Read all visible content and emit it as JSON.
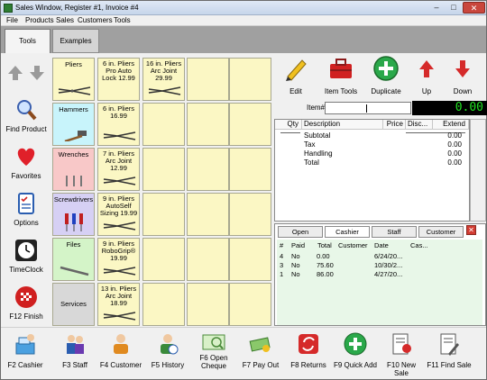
{
  "window": {
    "title": "Sales Window,  Register #1,  Invoice #4",
    "min": "–",
    "max": "□",
    "close": "✕"
  },
  "menu": [
    "File",
    "Products",
    "Sales",
    "Customers",
    "Tools"
  ],
  "tabs": {
    "tools": "Tools",
    "examples": "Examples"
  },
  "leftnav": {
    "find_product": "Find Product",
    "favorites": "Favorites",
    "options": "Options",
    "timeclock": "TimeClock",
    "f12_finish": "F12 Finish"
  },
  "categories": [
    "Pliers",
    "Hammers",
    "Wrenches",
    "Screwdrivers",
    "Files",
    "Services"
  ],
  "products_col1": [
    "6 in. Pliers Pro Auto Lock 12.99",
    "6 in. Pliers 16.99",
    "7 in. Pliers Arc Joint 12.99",
    "9 in. Pliers AutoSelf Sizing 19.99",
    "9 in. Pliers RoboGrip® 19.99",
    "13 in. Pliers Arc Joint 18.99"
  ],
  "products_col2": [
    "16 in. Pliers Arc Joint 29.99"
  ],
  "toolbar": {
    "edit": "Edit",
    "item_tools": "Item Tools",
    "duplicate": "Duplicate",
    "up": "Up",
    "down": "Down"
  },
  "item": {
    "label": "Item#",
    "value": "",
    "placeholder": ""
  },
  "total_display": "0.00",
  "lines": {
    "headers": [
      "Qty",
      "Description",
      "Price",
      "Disc...",
      "Extend"
    ],
    "rows": [
      {
        "label": "Subtotal",
        "value": "0.00"
      },
      {
        "label": "Tax",
        "value": "0.00"
      },
      {
        "label": "Handling",
        "value": "0.00"
      },
      {
        "label": "Total",
        "value": "0.00"
      }
    ]
  },
  "lower_tabs": [
    "Open",
    "Cashier",
    "Staff",
    "Customer"
  ],
  "invoices": {
    "headers": [
      "#",
      "Paid",
      "Total",
      "Customer",
      "Date",
      "Cas..."
    ],
    "rows": [
      {
        "num": "4",
        "paid": "No",
        "total": "0.00",
        "customer": "",
        "date": "6/24/20...",
        "cashier": ""
      },
      {
        "num": "3",
        "paid": "No",
        "total": "75.60",
        "customer": "",
        "date": "10/30/2...",
        "cashier": ""
      },
      {
        "num": "1",
        "paid": "No",
        "total": "86.00",
        "customer": "",
        "date": "4/27/20...",
        "cashier": ""
      }
    ]
  },
  "bottom": {
    "f2": "F2 Cashier",
    "f3": "F3 Staff",
    "f4": "F4 Customer",
    "f5": "F5 History",
    "f6a": "F6 Open",
    "f6b": "Cheque",
    "f7": "F7 Pay Out",
    "f8": "F8 Returns",
    "f9": "F9 Quick Add",
    "f10": "F10 New Sale",
    "f11": "F11 Find Sale"
  },
  "colors": {
    "pliers": "#fbf7c4",
    "hammers": "#c8f4fb",
    "wrenches": "#f8c8c8",
    "screwdrivers": "#d6d0f4",
    "files": "#d4f4c8",
    "services": "#d8d8d8",
    "total_text": "#22e022",
    "accent_green": "#2aa84a",
    "accent_red": "#d52a2a"
  }
}
